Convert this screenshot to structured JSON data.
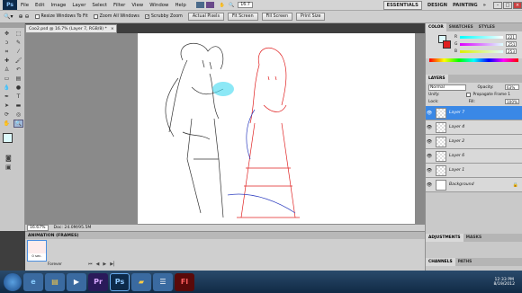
{
  "menubar": {
    "logo": "Ps",
    "items": [
      "File",
      "Edit",
      "Image",
      "Layer",
      "Select",
      "Filter",
      "View",
      "Window",
      "Help"
    ],
    "zoom_value": "16.7",
    "workspaces": [
      "ESSENTIALS",
      "DESIGN",
      "PAINTING",
      "»"
    ]
  },
  "options": {
    "resize_windows": "Resize Windows To Fit",
    "zoom_all": "Zoom All Windows",
    "scrubby_zoom": "Scrubby Zoom",
    "actual_pixels": "Actual Pixels",
    "fit_screen": "Fit Screen",
    "fill_screen": "Fill Screen",
    "print_size": "Print Size"
  },
  "document": {
    "tab_title": "Coo2.psd @ 16.7% (Layer 7, RGB/8) *",
    "zoom": "16.67%",
    "doc_size": "Doc: 24.0M/95.5M"
  },
  "animation": {
    "title": "ANIMATION (FRAMES)",
    "frame_time": "0 sec.",
    "loop": "Forever"
  },
  "color_panel": {
    "tabs": [
      "COLOR",
      "SWATCHES",
      "STYLES"
    ],
    "r": "221",
    "g": "251",
    "b": "253",
    "r_color": "#e03030",
    "g_color": "#30c030",
    "b_color": "#3050e0"
  },
  "layers_panel": {
    "tab": "LAYERS",
    "blend_mode": "Normal",
    "opacity_label": "Opacity:",
    "opacity": "63%",
    "unify_label": "Unify:",
    "propagate": "Propagate Frame 1",
    "lock_label": "Lock:",
    "fill_label": "Fill:",
    "fill": "100%",
    "layers": [
      {
        "name": "Layer 7",
        "selected": true
      },
      {
        "name": "Layer 4",
        "selected": false
      },
      {
        "name": "Layer 2",
        "selected": false
      },
      {
        "name": "Layer 6",
        "selected": false
      },
      {
        "name": "Layer 1",
        "selected": false
      },
      {
        "name": "Background",
        "selected": false
      }
    ]
  },
  "bottom_panels": {
    "tabs1": [
      "ADJUSTMENTS",
      "MASKS"
    ],
    "tabs2": [
      "CHANNELS",
      "PATHS"
    ]
  },
  "taskbar": {
    "time": "12:33 PM",
    "date": "8/19/2012"
  }
}
